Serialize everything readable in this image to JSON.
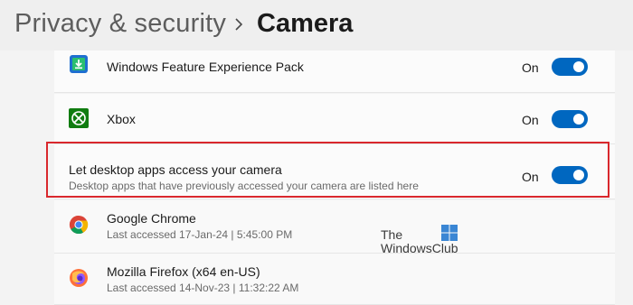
{
  "header": {
    "parent": "Privacy & security",
    "current": "Camera"
  },
  "apps": [
    {
      "name": "Windows Feature Experience Pack",
      "state": "On",
      "icon": "feature-pack-icon"
    },
    {
      "name": "Xbox",
      "state": "On",
      "icon": "xbox-icon"
    }
  ],
  "desktop_access": {
    "title": "Let desktop apps access your camera",
    "subtitle": "Desktop apps that have previously accessed your camera are listed here",
    "state": "On"
  },
  "desktop_apps": [
    {
      "name": "Google Chrome",
      "last_accessed": "Last accessed 17-Jan-24  |  5:45:00 PM",
      "icon": "chrome-icon"
    },
    {
      "name": "Mozilla Firefox (x64 en-US)",
      "last_accessed": "Last accessed 14-Nov-23  |  11:32:22 AM",
      "icon": "firefox-icon"
    }
  ],
  "watermark": {
    "line1": "The",
    "line2": "WindowsClub"
  },
  "colors": {
    "toggle_on": "#0067c0",
    "highlight": "#d9282d"
  }
}
